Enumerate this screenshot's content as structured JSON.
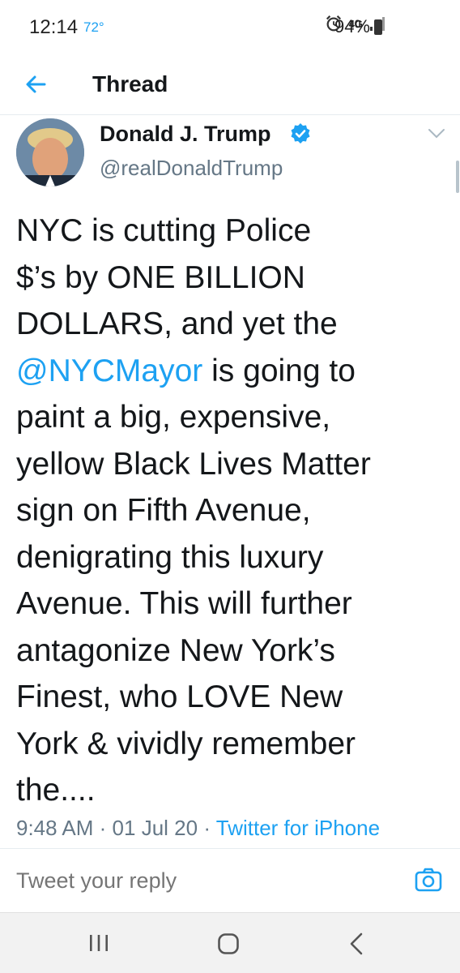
{
  "status_bar": {
    "time": "12:14",
    "temperature": "72°",
    "network": "4G",
    "battery": "94%",
    "icons": [
      "alarm-icon",
      "signal-icon",
      "battery-icon"
    ]
  },
  "header": {
    "title": "Thread",
    "back_icon": "arrow-left-icon"
  },
  "tweet": {
    "author_name": "Donald J. Trump",
    "author_handle": "@realDonaldTrump",
    "verified": true,
    "text_lines": [
      "NYC is cutting Police",
      "$’s by ONE BILLION",
      "DOLLARS, and yet the",
      {
        "mention": "@NYCMayor",
        "rest": " is going to"
      },
      "paint a big, expensive,",
      "yellow Black Lives Matter",
      "sign on Fifth Avenue,",
      "denigrating this luxury",
      "Avenue. This will further",
      "antagonize New York’s",
      "Finest, who LOVE New",
      "York & vividly remember",
      "the...."
    ],
    "time": "9:48 AM",
    "date": "01 Jul 20",
    "separator": "·",
    "source": "Twitter for iPhone"
  },
  "reply": {
    "placeholder": "Tweet your reply",
    "value": ""
  },
  "colors": {
    "accent": "#1da1f2",
    "text": "#14171a",
    "secondary": "#657786",
    "divider": "#e6ecf0"
  }
}
